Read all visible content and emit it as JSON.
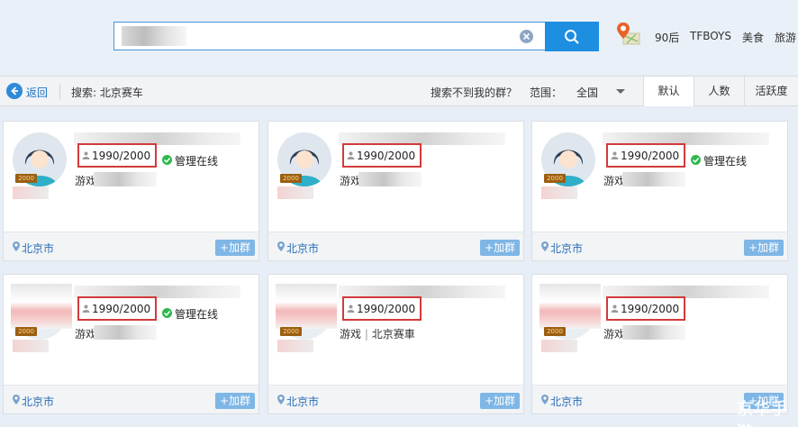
{
  "topbar": {
    "search_placeholder": "",
    "search_button_icon": "search-icon",
    "clear_icon": "clear-icon",
    "map_icon": "map-pin-icon",
    "hot_tags": [
      "90后",
      "TFBOYS",
      "美食",
      "旅游"
    ]
  },
  "toolbar": {
    "back_label": "返回",
    "search_query": "搜索: 北京赛车",
    "cant_find_label": "搜索不到我的群？",
    "range_label": "范围：",
    "range_value": "全国",
    "sort_tabs": [
      "默认",
      "人数",
      "活跃度"
    ]
  },
  "cards": [
    {
      "members": "1990/2000",
      "online_label": "管理在线",
      "tag": "游戏",
      "city": "北京市",
      "join_label": "+加群",
      "level": "2000"
    },
    {
      "members": "1990/2000",
      "online_label": "",
      "tag": "游戏",
      "city": "北京市",
      "join_label": "+加群",
      "level": "2000"
    },
    {
      "members": "1990/2000",
      "online_label": "管理在线",
      "tag": "游戏",
      "city": "北京市",
      "join_label": "+加群",
      "level": "2000"
    },
    {
      "members": "1990/2000",
      "online_label": "管理在线",
      "tag": "游戏",
      "city": "北京市",
      "join_label": "+加群",
      "level": "2000"
    },
    {
      "members": "1990/2000",
      "online_label": "",
      "tag": "游戏",
      "tag_extra": "北京赛車",
      "city": "北京市",
      "join_label": "+加群",
      "level": "2000"
    },
    {
      "members": "1990/2000",
      "online_label": "",
      "tag": "游戏",
      "city": "北京市",
      "join_label": "+加群",
      "level": "2000"
    }
  ],
  "watermark": "京华手游",
  "colors": {
    "accent": "#1d8ee0",
    "highlight_box": "#d33a3a",
    "online": "#2db84d",
    "city_link": "#2a6db5"
  }
}
